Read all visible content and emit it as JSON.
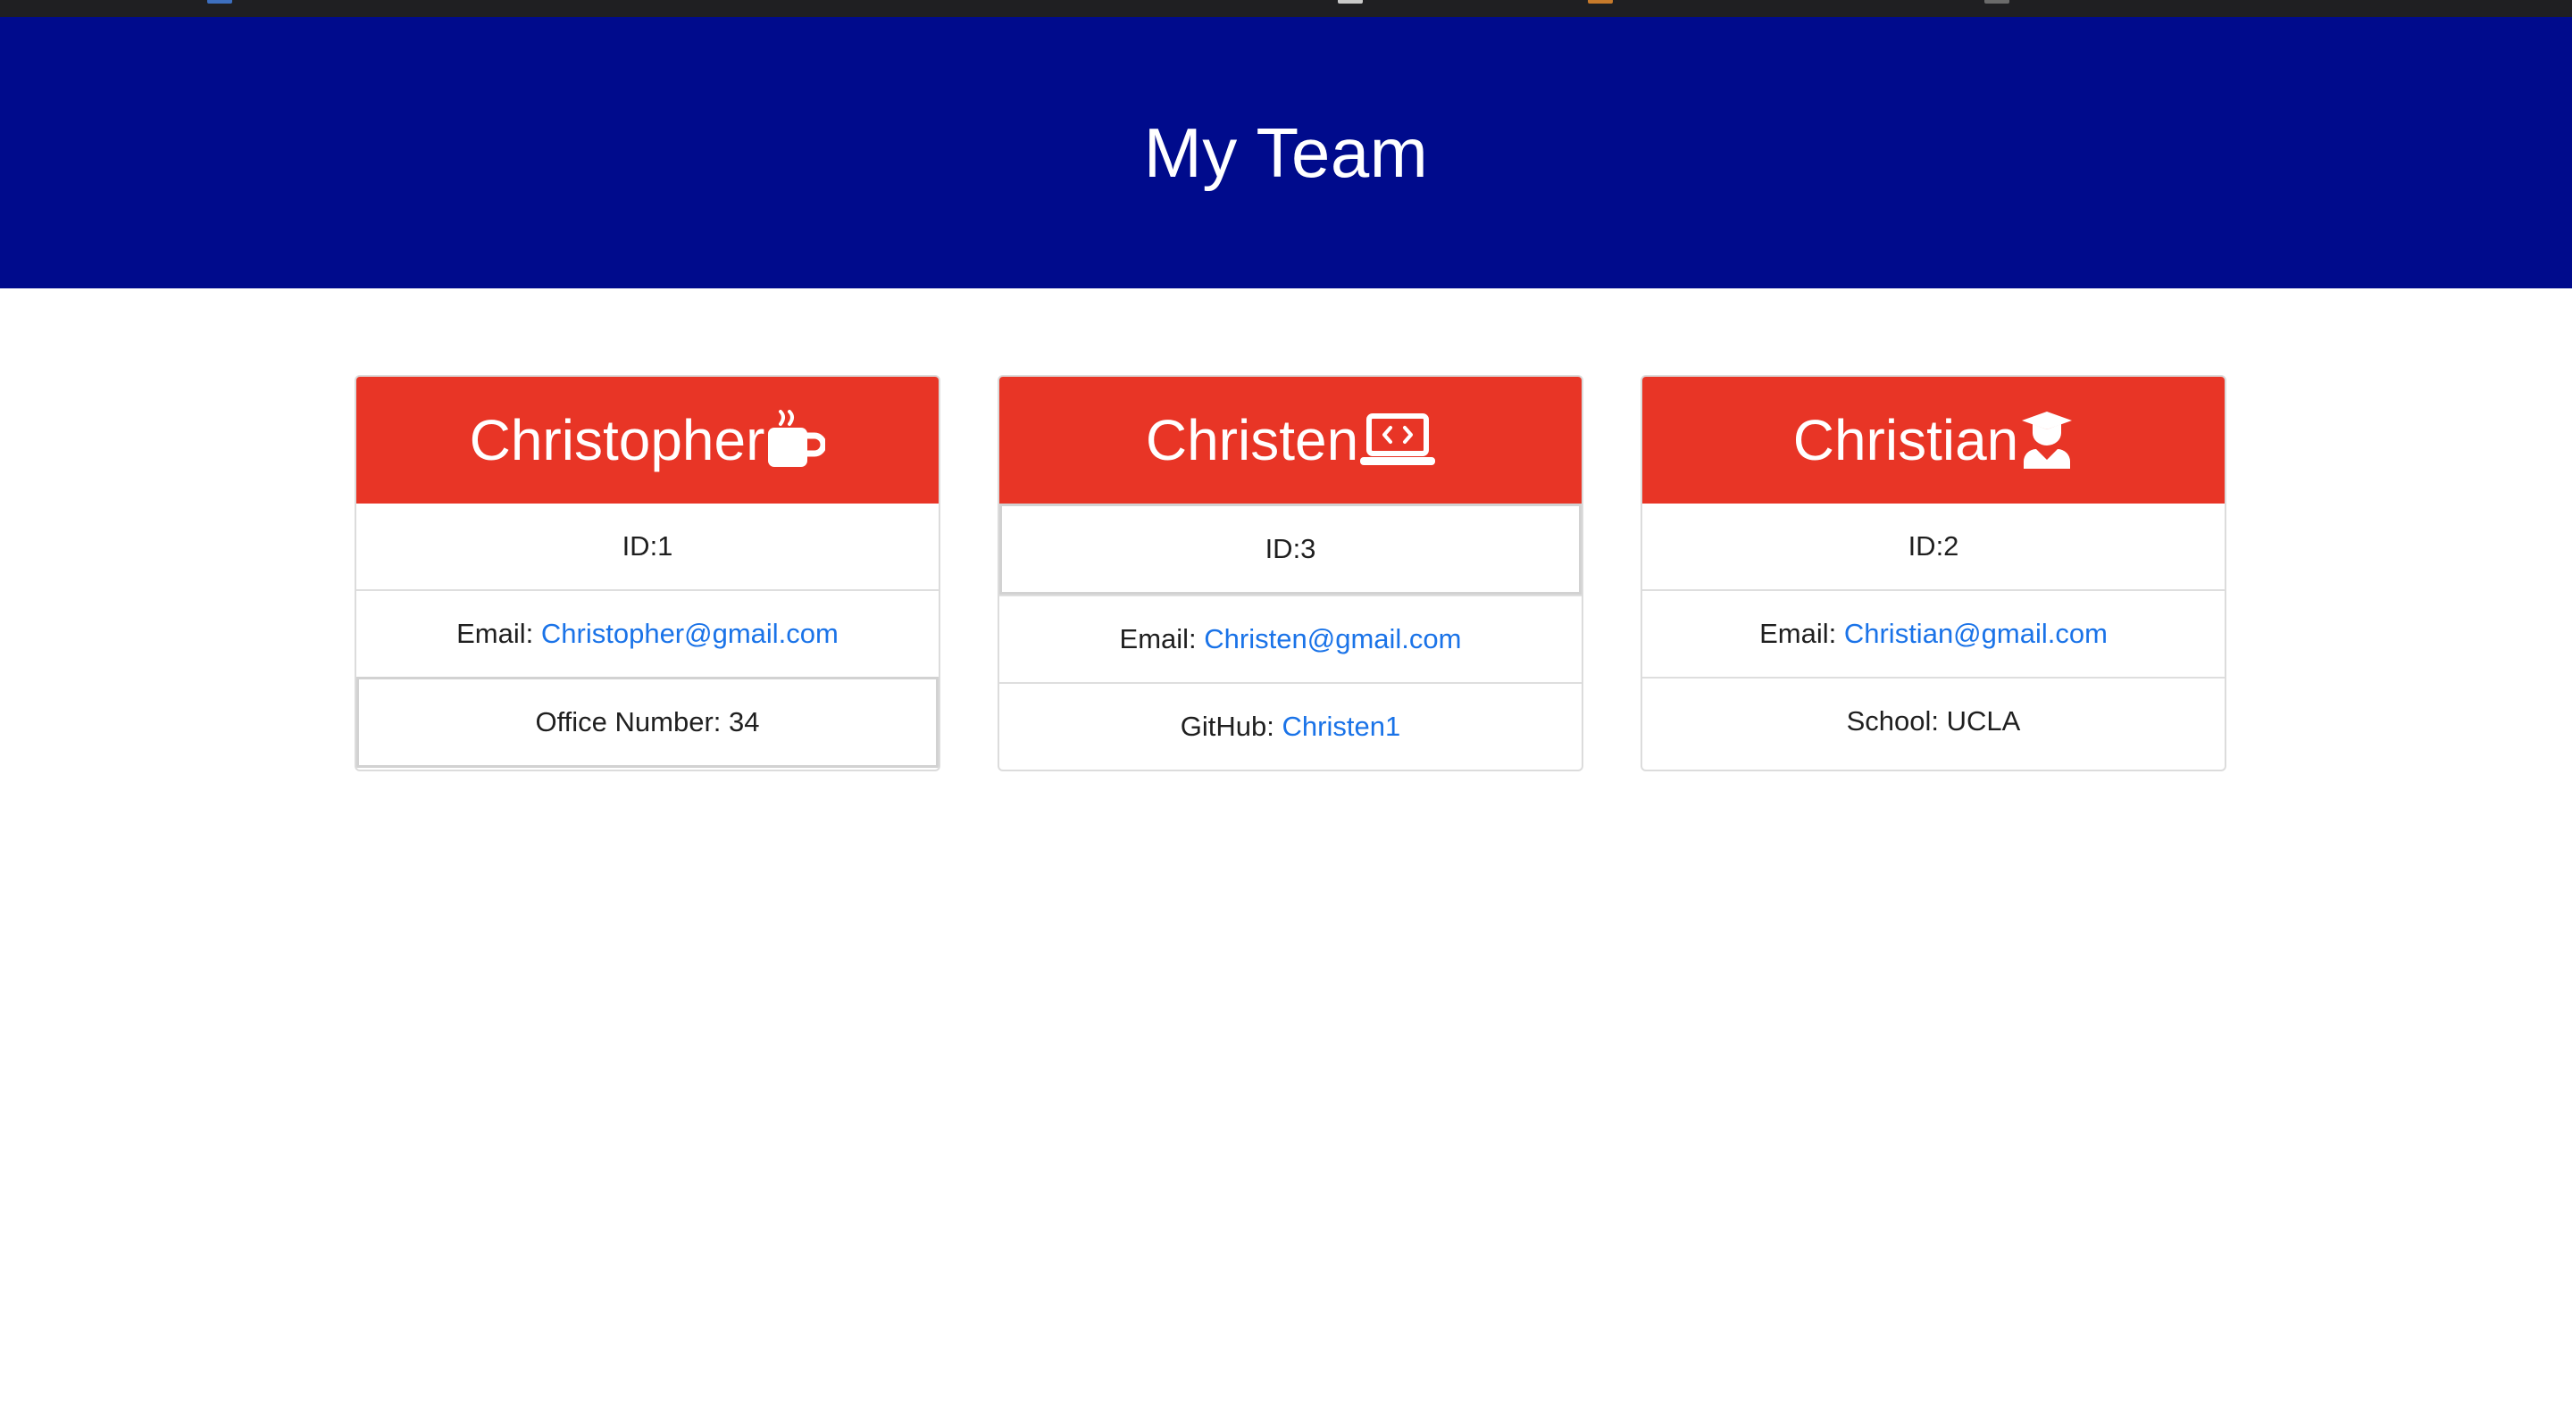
{
  "page": {
    "title": "My Team"
  },
  "colors": {
    "header_bg": "#000b8c",
    "card_header_bg": "#e83526",
    "link": "#1a73e8"
  },
  "team": [
    {
      "name": "Christopher",
      "icon": "coffee-mug-icon",
      "id_text": "ID:1",
      "email_label": "Email:",
      "email": "Christopher@gmail.com",
      "extra_label": "Office Number:",
      "extra_value": "34"
    },
    {
      "name": "Christen",
      "icon": "laptop-code-icon",
      "id_text": "ID:3",
      "email_label": "Email:",
      "email": "Christen@gmail.com",
      "extra_label": "GitHub:",
      "extra_value": "Christen1"
    },
    {
      "name": "Christian",
      "icon": "graduate-icon",
      "id_text": "ID:2",
      "email_label": "Email:",
      "email": "Christian@gmail.com",
      "extra_label": "School:",
      "extra_value": "UCLA"
    }
  ]
}
